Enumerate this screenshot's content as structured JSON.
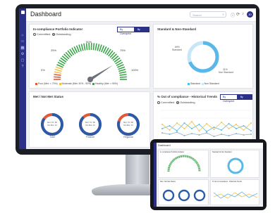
{
  "topbar": {
    "title": "Dashboard",
    "search_placeholder": "Search",
    "avatar_initials": "JD"
  },
  "sidebar": {
    "items": [
      "home",
      "folder",
      "grid",
      "settings",
      "chat",
      "help"
    ]
  },
  "compliance_card": {
    "title": "In-compliance Portfolio Indicator",
    "btn_current": "By Overspent",
    "btn_amount": "By Amount",
    "radio_committed": "Committed",
    "radio_outstanding": "Outstanding",
    "gauge_labels": {
      "l0": "0%",
      "l25": "25%",
      "l50": "50%",
      "l75": "75%",
      "l100": "100%"
    },
    "legend": [
      "Poor (Met: < 70%)",
      "Moderate (Met: 30% - 90%)",
      "Healthy (Met: > 90%)"
    ],
    "colors": {
      "poor": "#e05a3a",
      "moderate": "#f2c14e",
      "healthy": "#3aa54a"
    },
    "needle_value": 0.82
  },
  "standard_card": {
    "title": "Standard & Non-Standard",
    "label_standard_pct": "69%",
    "label_standard": "Standard",
    "label_nonstd_pct": "31%",
    "label_nonstd": "Non Standard",
    "legend": [
      "Standard",
      "Non Standard"
    ],
    "colors": {
      "standard": "#5ab8e8",
      "nonstandard": "#c7e6f7"
    },
    "fraction_standard": 0.69
  },
  "met_card": {
    "title": "Met / Not Met Status",
    "donuts": [
      {
        "name": "Total",
        "fill": 0.85
      },
      {
        "name": "Finance",
        "fill": 0.88
      },
      {
        "name": "Regional",
        "fill": 0.8
      }
    ],
    "center_line1": "Met: 70 / 80",
    "center_line2": "Not Met: 10"
  },
  "trend_card": {
    "title": "% Out of compliance - Historical Trends",
    "btn_current": "By Overspent",
    "btn_amount": "By Amount",
    "radio_committed": "Committed",
    "radio_outstanding": "Outstanding",
    "colors": {
      "a": "#5ab8e8",
      "b": "#f2c14e",
      "c": "#8fb0c8"
    }
  },
  "tablet": {
    "title": "Dashboard",
    "card1": "In-compliance Portfolio Indicator",
    "card2": "Standard & Non-Standard",
    "card3": "Met / Not Met Status",
    "card4": "% Out of compliance - Historical Trends"
  }
}
